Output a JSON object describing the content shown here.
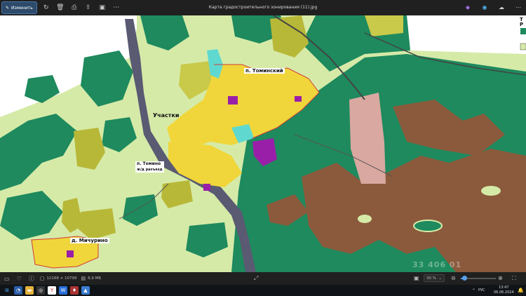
{
  "window": {
    "title": "Карта градостроительного зонирования (11).jpg"
  },
  "toolbar": {
    "edit_label": "Изменить"
  },
  "map": {
    "labels": {
      "tominsky": "п. Томинский",
      "uchastki": "Участки",
      "tomino": "п. Томино",
      "tomino_sub": "ж/д разъезд",
      "michurino": "д. Мичурино"
    },
    "legend_partial": {
      "line1": "Т",
      "line2": "Р"
    },
    "watermark": "33 406 01"
  },
  "statusbar": {
    "dimensions": "12168 × 10799",
    "size": "6,9 МБ",
    "zoom": "30 %"
  },
  "taskbar": {
    "lang": "РУС",
    "time": "13:47",
    "date": "06.06.2024"
  },
  "colors": {
    "forest": "#1e8a5e",
    "residential": "#f0d63a",
    "agri": "#c9c94a",
    "brown": "#8b5a3c",
    "pink": "#d9a8a0",
    "road": "#5a5a72",
    "light": "#d6eaa8"
  }
}
